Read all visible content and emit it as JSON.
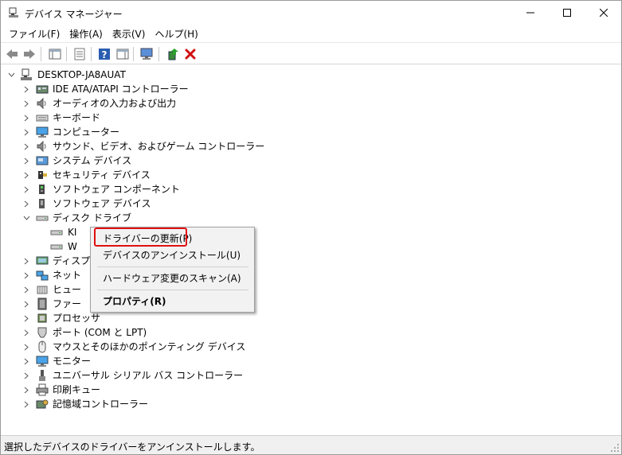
{
  "window": {
    "title": "デバイス マネージャー"
  },
  "menu": [
    "ファイル(F)",
    "操作(A)",
    "表示(V)",
    "ヘルプ(H)"
  ],
  "tree": {
    "root": "DESKTOP-JA8AUAT",
    "items": [
      {
        "label": "IDE ATA/ATAPI コントローラー",
        "icon": "ide-controller-icon",
        "expanded": false
      },
      {
        "label": "オーディオの入力および出力",
        "icon": "speaker-icon",
        "expanded": false
      },
      {
        "label": "キーボード",
        "icon": "keyboard-icon",
        "expanded": false
      },
      {
        "label": "コンピューター",
        "icon": "computer-icon",
        "expanded": false
      },
      {
        "label": "サウンド、ビデオ、およびゲーム コントローラー",
        "icon": "speaker-icon",
        "expanded": false
      },
      {
        "label": "システム デバイス",
        "icon": "system-device-icon",
        "expanded": false
      },
      {
        "label": "セキュリティ デバイス",
        "icon": "security-device-icon",
        "expanded": false
      },
      {
        "label": "ソフトウェア コンポーネント",
        "icon": "software-component-icon",
        "expanded": false
      },
      {
        "label": "ソフトウェア デバイス",
        "icon": "software-device-icon",
        "expanded": false
      },
      {
        "label": "ディスク ドライブ",
        "icon": "disk-drive-icon",
        "expanded": true
      },
      {
        "label": "KI",
        "icon": "disk-drive-icon",
        "child": true
      },
      {
        "label": "W",
        "icon": "disk-drive-icon",
        "child": true
      },
      {
        "label": "ディスプ",
        "icon": "display-adapter-icon",
        "expanded": false
      },
      {
        "label": "ネット",
        "icon": "network-icon",
        "expanded": false
      },
      {
        "label": "ヒュー",
        "icon": "hid-icon",
        "expanded": false
      },
      {
        "label": "ファー",
        "icon": "firmware-icon",
        "expanded": false
      },
      {
        "label": "プロセッサ",
        "icon": "processor-icon",
        "expanded": false
      },
      {
        "label": "ポート (COM と LPT)",
        "icon": "port-icon",
        "expanded": false
      },
      {
        "label": "マウスとそのほかのポインティング デバイス",
        "icon": "mouse-icon",
        "expanded": false
      },
      {
        "label": "モニター",
        "icon": "monitor-icon",
        "expanded": false
      },
      {
        "label": "ユニバーサル シリアル バス コントローラー",
        "icon": "usb-icon",
        "expanded": false
      },
      {
        "label": "印刷キュー",
        "icon": "printer-icon",
        "expanded": false
      },
      {
        "label": "記憶域コントローラー",
        "icon": "storage-controller-icon",
        "expanded": false
      }
    ]
  },
  "context_menu": {
    "update_driver": "ドライバーの更新(P)",
    "uninstall": "デバイスのアンインストール(U)",
    "scan": "ハードウェア変更のスキャン(A)",
    "properties": "プロパティ(R)"
  },
  "status": "選択したデバイスのドライバーをアンインストールします。",
  "colors": {
    "highlight": "#e01010",
    "accent": "#0078d7",
    "delete": "#d01010"
  }
}
